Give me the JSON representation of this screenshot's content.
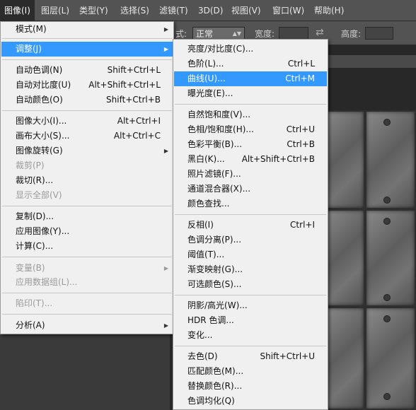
{
  "menubar": {
    "items": [
      "图像(I)",
      "图层(L)",
      "类型(Y)",
      "选择(S)",
      "滤镜(T)",
      "3D(D)",
      "视图(V)",
      "窗口(W)",
      "帮助(H)"
    ]
  },
  "options_bar": {
    "mode_label_suffix": "式:",
    "mode_value": "正常",
    "width_label": "宽度:",
    "height_label": "高度:"
  },
  "image_menu": {
    "items": [
      {
        "label": "模式(M)",
        "submenu": true
      },
      {
        "label": "调整(J)",
        "submenu": true,
        "highlighted": true
      },
      {
        "label": "自动色调(N)",
        "shortcut": "Shift+Ctrl+L"
      },
      {
        "label": "自动对比度(U)",
        "shortcut": "Alt+Shift+Ctrl+L"
      },
      {
        "label": "自动颜色(O)",
        "shortcut": "Shift+Ctrl+B"
      },
      {
        "label": "图像大小(I)...",
        "shortcut": "Alt+Ctrl+I"
      },
      {
        "label": "画布大小(S)...",
        "shortcut": "Alt+Ctrl+C"
      },
      {
        "label": "图像旋转(G)",
        "submenu": true
      },
      {
        "label": "裁剪(P)",
        "disabled": true
      },
      {
        "label": "裁切(R)..."
      },
      {
        "label": "显示全部(V)",
        "disabled": true
      },
      {
        "label": "复制(D)..."
      },
      {
        "label": "应用图像(Y)..."
      },
      {
        "label": "计算(C)..."
      },
      {
        "label": "变量(B)",
        "submenu": true,
        "disabled": true
      },
      {
        "label": "应用数据组(L)...",
        "disabled": true
      },
      {
        "label": "陷印(T)...",
        "disabled": true
      },
      {
        "label": "分析(A)",
        "submenu": true
      }
    ]
  },
  "adjust_menu": {
    "items": [
      {
        "label": "亮度/对比度(C)..."
      },
      {
        "label": "色阶(L)...",
        "shortcut": "Ctrl+L"
      },
      {
        "label": "曲线(U)...",
        "shortcut": "Ctrl+M",
        "highlighted": true
      },
      {
        "label": "曝光度(E)..."
      },
      {
        "label": "自然饱和度(V)..."
      },
      {
        "label": "色相/饱和度(H)...",
        "shortcut": "Ctrl+U"
      },
      {
        "label": "色彩平衡(B)...",
        "shortcut": "Ctrl+B"
      },
      {
        "label": "黑白(K)...",
        "shortcut": "Alt+Shift+Ctrl+B"
      },
      {
        "label": "照片滤镜(F)..."
      },
      {
        "label": "通道混合器(X)..."
      },
      {
        "label": "颜色查找..."
      },
      {
        "label": "反相(I)",
        "shortcut": "Ctrl+I"
      },
      {
        "label": "色调分离(P)..."
      },
      {
        "label": "阈值(T)..."
      },
      {
        "label": "渐变映射(G)..."
      },
      {
        "label": "可选颜色(S)..."
      },
      {
        "label": "阴影/高光(W)..."
      },
      {
        "label": "HDR 色调..."
      },
      {
        "label": "变化..."
      },
      {
        "label": "去色(D)",
        "shortcut": "Shift+Ctrl+U"
      },
      {
        "label": "匹配颜色(M)..."
      },
      {
        "label": "替换颜色(R)..."
      },
      {
        "label": "色调均化(Q)"
      }
    ]
  },
  "colors": {
    "highlight": "#3399ff",
    "menu_bg": "#f0f0f0",
    "menubar_bg": "#535353"
  }
}
